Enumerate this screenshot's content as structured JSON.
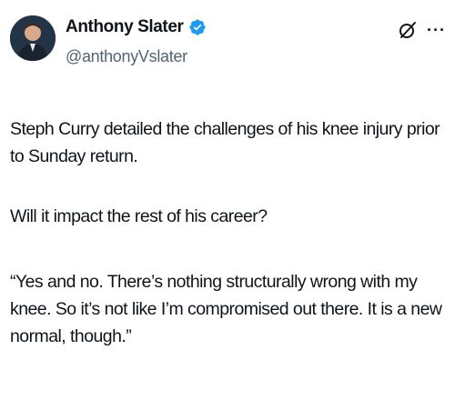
{
  "author": {
    "display_name": "Anthony Slater",
    "handle": "@anthonyVslater",
    "verified": true,
    "verified_color": "#1d9bf0"
  },
  "actions": {
    "grok_icon": "grok-icon",
    "more_icon": "more-icon",
    "more_glyph": "···"
  },
  "tweet": {
    "paragraphs": [
      "Steph Curry detailed the challenges of his knee injury prior to Sunday return.",
      "Will it impact the rest of his career?",
      "“Yes and no. There’s nothing structurally wrong with my knee. So it’s not like I’m compromised out there. It is a new normal, though.”"
    ]
  },
  "colors": {
    "text": "#0f1419",
    "secondary_text": "#536471",
    "background": "#ffffff"
  }
}
